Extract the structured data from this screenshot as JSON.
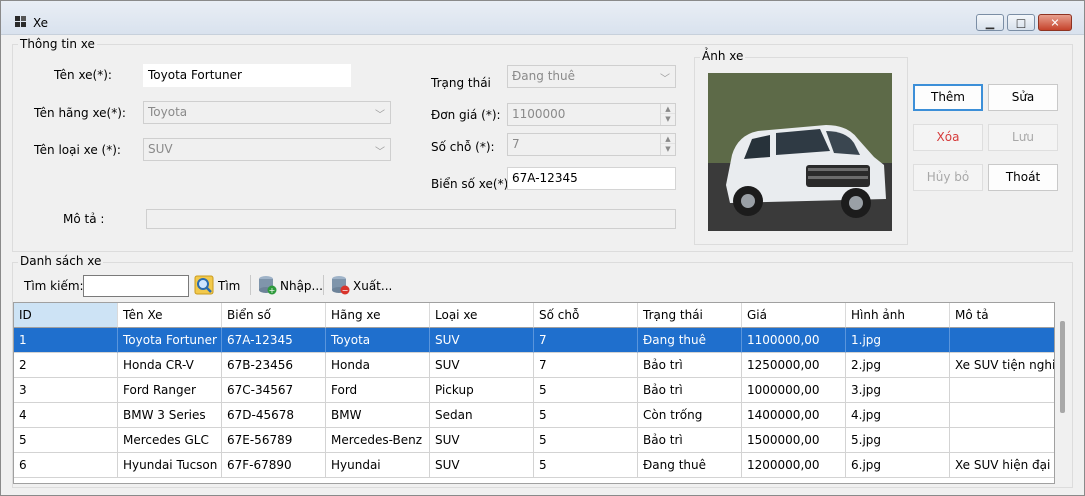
{
  "window": {
    "title": "Xe"
  },
  "info_group": {
    "title": "Thông tin  xe",
    "ten_xe_label": "Tên xe(*):",
    "ten_xe_value": "Toyota Fortuner",
    "ten_hang_label": "Tên hãng xe(*):",
    "ten_hang_value": "Toyota",
    "ten_loai_label": "Tên loại xe (*):",
    "ten_loai_value": "SUV",
    "mo_ta_label": "Mô tả :",
    "mo_ta_value": "",
    "trang_thai_label": "Trạng thái",
    "trang_thai_value": "Đang thuê",
    "don_gia_label": "Đơn giá (*):",
    "don_gia_value": "1100000",
    "so_cho_label": "Số chỗ (*):",
    "so_cho_value": "7",
    "bien_so_label": "Biển số xe(*):",
    "bien_so_value": "67A-12345"
  },
  "image_group": {
    "title": "Ảnh xe"
  },
  "actions": {
    "them": "Thêm",
    "sua": "Sửa",
    "xoa": "Xóa",
    "luu": "Lưu",
    "huy_bo": "Hủy bỏ",
    "thoat": "Thoát"
  },
  "list_group": {
    "title": "Danh sách xe"
  },
  "toolbar": {
    "search_label": "Tìm kiếm:",
    "search_value": "",
    "tim": "Tìm",
    "nhap": "Nhập...",
    "xuat": "Xuất..."
  },
  "grid": {
    "columns": [
      "ID",
      "Tên Xe",
      "Biển số",
      "Hãng xe",
      "Loại xe",
      "Số chỗ",
      "Trạng thái",
      "Giá",
      "Hình ảnh",
      "Mô tả"
    ],
    "rows": [
      [
        "1",
        "Toyota Fortuner",
        "67A-12345",
        "Toyota",
        "SUV",
        "7",
        "Đang thuê",
        "1100000,00",
        "1.jpg",
        ""
      ],
      [
        "2",
        "Honda CR-V",
        "67B-23456",
        "Honda",
        "SUV",
        "7",
        "Bảo trì",
        "1250000,00",
        "2.jpg",
        "Xe SUV tiện nghi"
      ],
      [
        "3",
        "Ford Ranger",
        "67C-34567",
        "Ford",
        "Pickup",
        "5",
        "Bảo trì",
        "1000000,00",
        "3.jpg",
        ""
      ],
      [
        "4",
        "BMW 3 Series",
        "67D-45678",
        "BMW",
        "Sedan",
        "5",
        "Còn trống",
        "1400000,00",
        "4.jpg",
        ""
      ],
      [
        "5",
        "Mercedes GLC",
        "67E-56789",
        "Mercedes-Benz",
        "SUV",
        "5",
        "Bảo trì",
        "1500000,00",
        "5.jpg",
        ""
      ],
      [
        "6",
        "Hyundai Tucson",
        "67F-67890",
        "Hyundai",
        "SUV",
        "5",
        "Đang thuê",
        "1200000,00",
        "6.jpg",
        "Xe SUV hiện đại"
      ]
    ]
  }
}
